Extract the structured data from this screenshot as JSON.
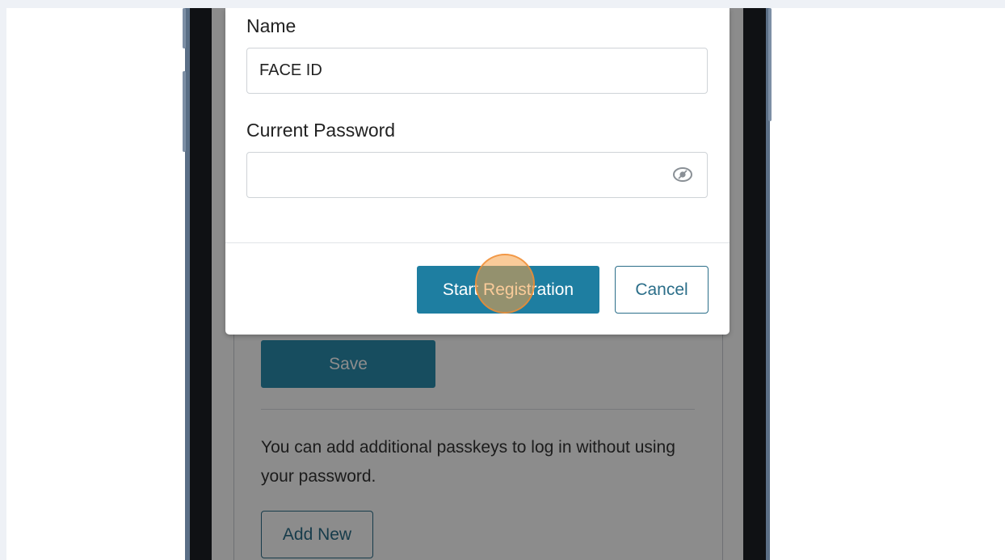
{
  "modal": {
    "name_label": "Name",
    "name_value": "FACE ID",
    "password_label": "Current Password",
    "password_value": "",
    "start_button": "Start Registration",
    "cancel_button": "Cancel",
    "eye_icon": "eye-icon"
  },
  "page": {
    "save_button": "Save",
    "info_text": "You can add additional passkeys to log in without using your password.",
    "add_new_button": "Add New"
  },
  "colors": {
    "accent": "#1e7ea1",
    "outline": "#2b6e89",
    "click_marker": "#f5a046"
  }
}
